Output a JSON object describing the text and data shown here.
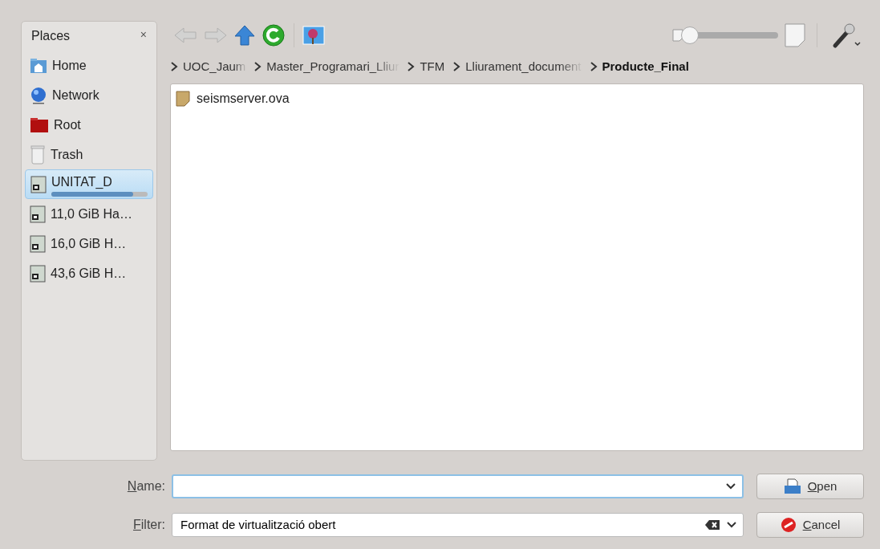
{
  "places": {
    "title": "Places",
    "close": "×",
    "items": [
      {
        "label": "Home",
        "kind": "home",
        "selected": false
      },
      {
        "label": "Network",
        "kind": "network",
        "selected": false
      },
      {
        "label": "Root",
        "kind": "root",
        "selected": false
      },
      {
        "label": "Trash",
        "kind": "trash",
        "selected": false
      },
      {
        "label": "UNITAT_D",
        "kind": "drive",
        "selected": true,
        "level": 0.85
      },
      {
        "label": "11,0 GiB Ha…",
        "kind": "drive",
        "selected": false
      },
      {
        "label": "16,0 GiB H…",
        "kind": "drive",
        "selected": false
      },
      {
        "label": "43,6 GiB H…",
        "kind": "drive",
        "selected": false
      }
    ]
  },
  "toolbar": {
    "back_disabled": true,
    "forward_disabled": true,
    "zoom": {
      "level": 0
    }
  },
  "breadcrumb": [
    {
      "label": "UOC_Jaum",
      "current": false,
      "faded": true
    },
    {
      "label": "Master_Programari_Lliur",
      "current": false,
      "faded": true
    },
    {
      "label": "TFM",
      "current": false,
      "faded": false
    },
    {
      "label": "Lliurament_document",
      "current": false,
      "faded": true
    },
    {
      "label": "Producte_Final",
      "current": true,
      "faded": false
    }
  ],
  "files": [
    {
      "name": "seismserver.ova"
    }
  ],
  "name_field": {
    "label": "Name:"
  },
  "filter_field": {
    "label": "Filter:",
    "value": "Format de virtualització obert"
  },
  "buttons": [
    {
      "label": "Open",
      "kind": "open"
    },
    {
      "label": "Cancel",
      "kind": "cancel"
    }
  ]
}
